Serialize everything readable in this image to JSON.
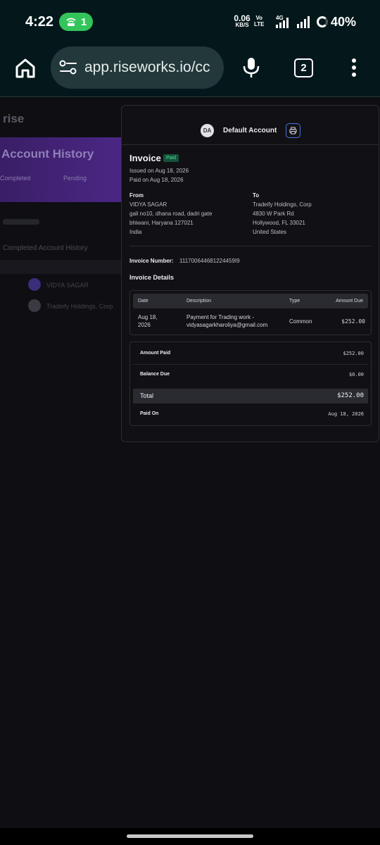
{
  "status_bar": {
    "time": "4:22",
    "hotspot_count": "1",
    "net_speed_value": "0.06",
    "net_speed_unit": "KB/S",
    "volte_line1": "Vo",
    "volte_line2": "LTE",
    "network_type": "4G",
    "battery_percent": "40%"
  },
  "browser": {
    "url": "app.riseworks.io/cc",
    "tab_count": "2"
  },
  "background_app": {
    "logo": "rise",
    "banner_title": "Account History",
    "tab_completed": "Completed",
    "tab_pending": "Pending",
    "section_title": "Completed Account History",
    "row1_name": "VIDYA SAGAR",
    "row2_name": "Tradeify Holdings, Corp"
  },
  "modal": {
    "avatar_initials": "DA",
    "account_name": "Default Account",
    "invoice_title": "Invoice",
    "status_badge": "Paid",
    "issued_on": "Issued on Aug 18, 2026",
    "paid_on": "Paid on Aug 18, 2026",
    "from": {
      "label": "From",
      "lines": [
        "VIDYA SAGAR",
        "gali no10, dhana road, dadri gate",
        "bhiwani, Haryana 127021",
        "India"
      ]
    },
    "to": {
      "label": "To",
      "lines": [
        "Tradeify Holdings, Corp",
        "4830 W Park Rd",
        "Hollywood, FL 33021",
        "United States"
      ]
    },
    "invoice_number_label": "Invoice Number:",
    "invoice_number": "111700644681224459I9",
    "details_title": "Invoice Details",
    "table": {
      "headers": [
        "Date",
        "Description",
        "Type",
        "Amount Due"
      ],
      "rows": [
        {
          "date_line1": "Aug 18,",
          "date_line2": "2026",
          "desc_line1": "Payment for Trading work -",
          "desc_line2": "vidyasagarkharoliya@gmail.com",
          "type": "Common",
          "amount": "$252.00"
        }
      ]
    },
    "summary": {
      "amount_paid_label": "Amount Paid",
      "amount_paid": "$252.00",
      "balance_due_label": "Balance Due",
      "balance_due": "$0.00",
      "total_label": "Total",
      "total": "$252.00",
      "paid_on_label": "Paid On",
      "paid_on": "Aug 18, 2026"
    }
  },
  "colors": {
    "status_bar_bg": "#04181c",
    "hotspot_green": "#33c45a",
    "modal_bg": "#111115",
    "paid_badge_bg": "#17513a",
    "paid_badge_text": "#4ee39a",
    "print_border": "#4a74d9",
    "banner_purple": "#4b2785"
  }
}
